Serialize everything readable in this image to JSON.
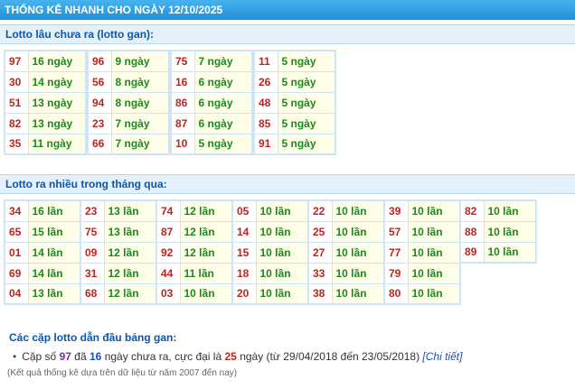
{
  "header": {
    "title": "THỐNG KÊ NHANH CHO NGÀY 12/10/2025"
  },
  "gan": {
    "heading": "Lotto lâu chưa ra (lotto gan):",
    "tables": [
      [
        [
          "97",
          "16 ngày"
        ],
        [
          "30",
          "14 ngày"
        ],
        [
          "51",
          "13 ngày"
        ],
        [
          "82",
          "13 ngày"
        ],
        [
          "35",
          "11 ngày"
        ]
      ],
      [
        [
          "96",
          "9 ngày"
        ],
        [
          "56",
          "8 ngày"
        ],
        [
          "94",
          "8 ngày"
        ],
        [
          "23",
          "7 ngày"
        ],
        [
          "66",
          "7 ngày"
        ]
      ],
      [
        [
          "75",
          "7 ngày"
        ],
        [
          "16",
          "6 ngày"
        ],
        [
          "86",
          "6 ngày"
        ],
        [
          "87",
          "6 ngày"
        ],
        [
          "10",
          "5 ngày"
        ]
      ],
      [
        [
          "11",
          "5 ngày"
        ],
        [
          "26",
          "5 ngày"
        ],
        [
          "48",
          "5 ngày"
        ],
        [
          "85",
          "5 ngày"
        ],
        [
          "91",
          "5 ngày"
        ]
      ]
    ]
  },
  "nhieu": {
    "heading": "Lotto ra nhiều trong tháng qua:",
    "tables": [
      [
        [
          "34",
          "16 lần"
        ],
        [
          "65",
          "15 lần"
        ],
        [
          "01",
          "14 lần"
        ],
        [
          "69",
          "14 lần"
        ],
        [
          "04",
          "13 lần"
        ]
      ],
      [
        [
          "23",
          "13 lần"
        ],
        [
          "75",
          "13 lần"
        ],
        [
          "09",
          "12 lần"
        ],
        [
          "31",
          "12 lần"
        ],
        [
          "68",
          "12 lần"
        ]
      ],
      [
        [
          "74",
          "12 lần"
        ],
        [
          "87",
          "12 lần"
        ],
        [
          "92",
          "12 lần"
        ],
        [
          "44",
          "11 lần"
        ],
        [
          "03",
          "10 lần"
        ]
      ],
      [
        [
          "05",
          "10 lần"
        ],
        [
          "14",
          "10 lần"
        ],
        [
          "15",
          "10 lần"
        ],
        [
          "18",
          "10 lần"
        ],
        [
          "20",
          "10 lần"
        ]
      ],
      [
        [
          "22",
          "10 lần"
        ],
        [
          "25",
          "10 lần"
        ],
        [
          "27",
          "10 lần"
        ],
        [
          "33",
          "10 lần"
        ],
        [
          "38",
          "10 lần"
        ]
      ],
      [
        [
          "39",
          "10 lần"
        ],
        [
          "57",
          "10 lần"
        ],
        [
          "77",
          "10 lần"
        ],
        [
          "79",
          "10 lần"
        ],
        [
          "80",
          "10 lần"
        ]
      ],
      [
        [
          "82",
          "10 lần"
        ],
        [
          "88",
          "10 lần"
        ],
        [
          "89",
          "10 lần"
        ]
      ]
    ]
  },
  "pairs": {
    "heading": "Các cặp lotto dẫn đầu bảng gan:",
    "prefix": "Cặp số",
    "pair": "97",
    "mid1": "đã",
    "days": "16",
    "mid2": "ngày chưa ra, cực đại là",
    "max": "25",
    "suffix": "ngày (từ 29/04/2018 đến 23/05/2018)",
    "link": "[Chi tiết]"
  },
  "footnote": "(Kết quả thống kê dựa trên dữ liệu từ năm 2007 đến nay)"
}
